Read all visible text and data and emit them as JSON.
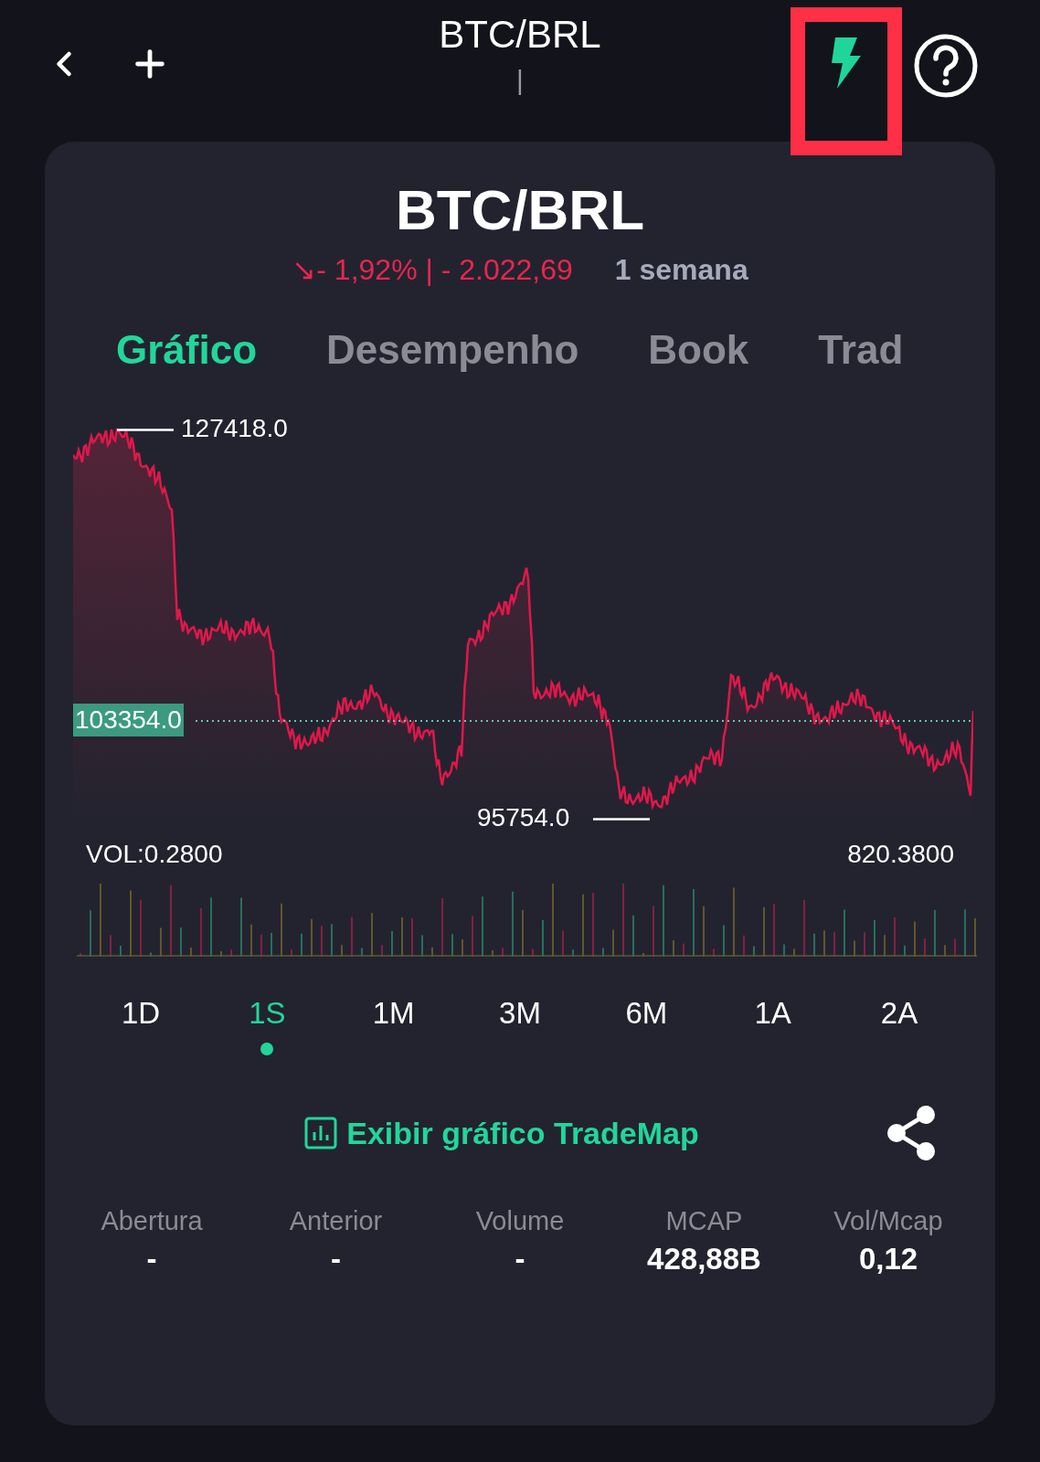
{
  "header": {
    "title": "BTC/BRL",
    "subtitle": "|"
  },
  "card": {
    "title": "BTC/BRL",
    "change": "↘- 1,92% | - 2.022,69",
    "period": "1 semana"
  },
  "tabs": [
    {
      "label": "Gráfico",
      "selected": true
    },
    {
      "label": "Desempenho",
      "selected": false
    },
    {
      "label": "Book",
      "selected": false
    },
    {
      "label": "Trad",
      "selected": false
    }
  ],
  "chart": {
    "max_label": "127418.0",
    "min_label": "95754.0",
    "last_price": "103354.0",
    "vol_label": "VOL:0.2800",
    "vol_max": "820.3800"
  },
  "periods": [
    {
      "label": "1D",
      "selected": false
    },
    {
      "label": "1S",
      "selected": true
    },
    {
      "label": "1M",
      "selected": false
    },
    {
      "label": "3M",
      "selected": false
    },
    {
      "label": "6M",
      "selected": false
    },
    {
      "label": "1A",
      "selected": false
    },
    {
      "label": "2A",
      "selected": false
    }
  ],
  "link": "Exibir gráfico TradeMap",
  "stats": [
    {
      "label": "Abertura",
      "value": "-"
    },
    {
      "label": "Anterior",
      "value": "-"
    },
    {
      "label": "Volume",
      "value": "-"
    },
    {
      "label": "MCAP",
      "value": "428,88B"
    },
    {
      "label": "Vol/Mcap",
      "value": "0,12"
    }
  ]
}
